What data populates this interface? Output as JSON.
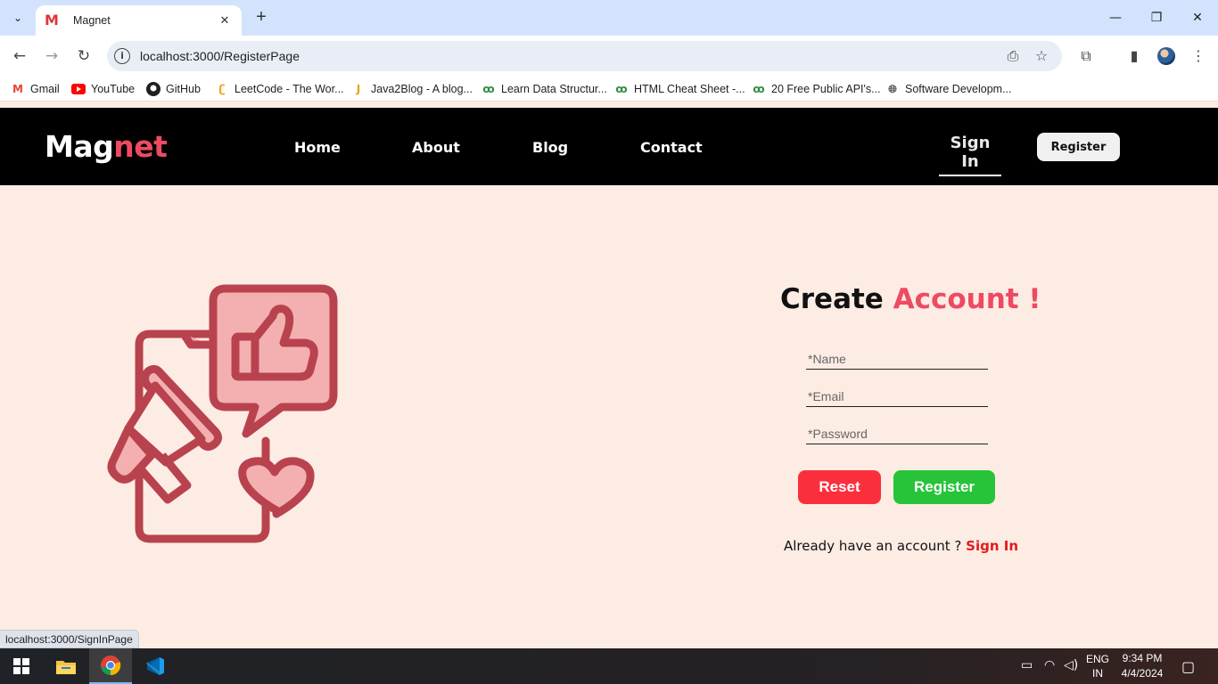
{
  "browser": {
    "tab": {
      "title": "Magnet",
      "favicon": "M"
    },
    "url": "localhost:3000/RegisterPage",
    "bookmarks": [
      {
        "label": "Gmail",
        "icon": "gmail-icon"
      },
      {
        "label": "YouTube",
        "icon": "youtube-icon"
      },
      {
        "label": "GitHub",
        "icon": "github-icon"
      },
      {
        "label": "LeetCode - The Wor...",
        "icon": "leetcode-icon"
      },
      {
        "label": "Java2Blog - A blog...",
        "icon": "java2blog-icon"
      },
      {
        "label": "Learn Data Structur...",
        "icon": "gfg-icon"
      },
      {
        "label": "HTML Cheat Sheet -...",
        "icon": "gfg-icon"
      },
      {
        "label": "20 Free Public API's...",
        "icon": "gfg-icon"
      },
      {
        "label": "Software Developm...",
        "icon": "globe-icon"
      }
    ],
    "status_url": "localhost:3000/SignInPage"
  },
  "site": {
    "logo": {
      "part1": "Mag",
      "part2": "net"
    },
    "nav": [
      "Home",
      "About",
      "Blog",
      "Contact"
    ],
    "signin_label": "Sign In",
    "register_label": "Register"
  },
  "form": {
    "title_part1": "Create",
    "title_part2": "Account !",
    "name_placeholder": "*Name",
    "email_placeholder": "*Email",
    "password_placeholder": "*Password",
    "reset_label": "Reset",
    "register_label": "Register",
    "already_text": "Already have an account ?",
    "signin_link": "Sign In"
  },
  "taskbar": {
    "lang": "ENG",
    "region": "IN",
    "time": "9:34 PM",
    "date": "4/4/2024"
  },
  "colors": {
    "accent_pink": "#ee4a62",
    "page_bg": "#fdece3",
    "reset_red": "#fb2f3c",
    "register_green": "#27c43a",
    "illustration_stroke": "#b8434f",
    "illustration_fill": "#f4b0b0"
  }
}
